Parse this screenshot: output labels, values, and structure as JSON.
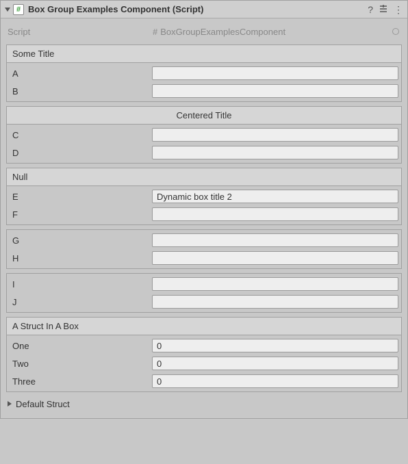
{
  "header": {
    "title": "Box Group Examples Component (Script)",
    "hash_glyph": "#"
  },
  "script": {
    "label": "Script",
    "value": "BoxGroupExamplesComponent",
    "prefix_glyph": "#"
  },
  "boxes": [
    {
      "title": "Some Title",
      "centered": false,
      "fields": [
        {
          "label": "A",
          "value": ""
        },
        {
          "label": "B",
          "value": ""
        }
      ]
    },
    {
      "title": "Centered Title",
      "centered": true,
      "fields": [
        {
          "label": "C",
          "value": ""
        },
        {
          "label": "D",
          "value": ""
        }
      ]
    },
    {
      "title": "Null",
      "centered": false,
      "fields": [
        {
          "label": "E",
          "value": "Dynamic box title 2"
        },
        {
          "label": "F",
          "value": ""
        }
      ]
    },
    {
      "title": null,
      "centered": false,
      "fields": [
        {
          "label": "G",
          "value": ""
        },
        {
          "label": "H",
          "value": ""
        }
      ]
    },
    {
      "title": null,
      "centered": false,
      "fields": [
        {
          "label": "I",
          "value": ""
        },
        {
          "label": "J",
          "value": ""
        }
      ]
    },
    {
      "title": "A Struct In A Box",
      "centered": false,
      "fields": [
        {
          "label": "One",
          "value": "0"
        },
        {
          "label": "Two",
          "value": "0"
        },
        {
          "label": "Three",
          "value": "0"
        }
      ]
    }
  ],
  "default_struct": {
    "label": "Default Struct"
  }
}
